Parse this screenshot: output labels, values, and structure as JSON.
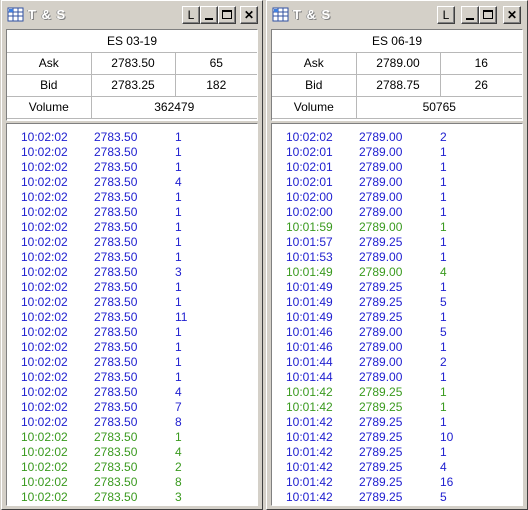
{
  "colors": {
    "buy": "#2020d0",
    "sell": "#3a9a1e",
    "window": "#d4d0c8"
  },
  "windows": [
    {
      "title": "T & S",
      "icon": "grid-app-icon",
      "buttons": {
        "link": "L"
      },
      "symbol": "ES 03-19",
      "ask_label": "Ask",
      "ask_price": "2783.50",
      "ask_size": "65",
      "bid_label": "Bid",
      "bid_price": "2783.25",
      "bid_size": "182",
      "volume_label": "Volume",
      "volume": "362479",
      "trades": [
        {
          "time": "10:02:02",
          "price": "2783.50",
          "size": "1",
          "side": "blue"
        },
        {
          "time": "10:02:02",
          "price": "2783.50",
          "size": "1",
          "side": "blue"
        },
        {
          "time": "10:02:02",
          "price": "2783.50",
          "size": "1",
          "side": "blue"
        },
        {
          "time": "10:02:02",
          "price": "2783.50",
          "size": "4",
          "side": "blue"
        },
        {
          "time": "10:02:02",
          "price": "2783.50",
          "size": "1",
          "side": "blue"
        },
        {
          "time": "10:02:02",
          "price": "2783.50",
          "size": "1",
          "side": "blue"
        },
        {
          "time": "10:02:02",
          "price": "2783.50",
          "size": "1",
          "side": "blue"
        },
        {
          "time": "10:02:02",
          "price": "2783.50",
          "size": "1",
          "side": "blue"
        },
        {
          "time": "10:02:02",
          "price": "2783.50",
          "size": "1",
          "side": "blue"
        },
        {
          "time": "10:02:02",
          "price": "2783.50",
          "size": "3",
          "side": "blue"
        },
        {
          "time": "10:02:02",
          "price": "2783.50",
          "size": "1",
          "side": "blue"
        },
        {
          "time": "10:02:02",
          "price": "2783.50",
          "size": "1",
          "side": "blue"
        },
        {
          "time": "10:02:02",
          "price": "2783.50",
          "size": "11",
          "side": "blue"
        },
        {
          "time": "10:02:02",
          "price": "2783.50",
          "size": "1",
          "side": "blue"
        },
        {
          "time": "10:02:02",
          "price": "2783.50",
          "size": "1",
          "side": "blue"
        },
        {
          "time": "10:02:02",
          "price": "2783.50",
          "size": "1",
          "side": "blue"
        },
        {
          "time": "10:02:02",
          "price": "2783.50",
          "size": "1",
          "side": "blue"
        },
        {
          "time": "10:02:02",
          "price": "2783.50",
          "size": "4",
          "side": "blue"
        },
        {
          "time": "10:02:02",
          "price": "2783.50",
          "size": "7",
          "side": "blue"
        },
        {
          "time": "10:02:02",
          "price": "2783.50",
          "size": "8",
          "side": "blue"
        },
        {
          "time": "10:02:02",
          "price": "2783.50",
          "size": "1",
          "side": "green"
        },
        {
          "time": "10:02:02",
          "price": "2783.50",
          "size": "4",
          "side": "green"
        },
        {
          "time": "10:02:02",
          "price": "2783.50",
          "size": "2",
          "side": "green"
        },
        {
          "time": "10:02:02",
          "price": "2783.50",
          "size": "8",
          "side": "green"
        },
        {
          "time": "10:02:02",
          "price": "2783.50",
          "size": "3",
          "side": "green"
        }
      ]
    },
    {
      "title": "T & S",
      "icon": "grid-app-icon",
      "buttons": {
        "link": "L"
      },
      "symbol": "ES 06-19",
      "ask_label": "Ask",
      "ask_price": "2789.00",
      "ask_size": "16",
      "bid_label": "Bid",
      "bid_price": "2788.75",
      "bid_size": "26",
      "volume_label": "Volume",
      "volume": "50765",
      "trades": [
        {
          "time": "10:02:02",
          "price": "2789.00",
          "size": "2",
          "side": "blue"
        },
        {
          "time": "10:02:01",
          "price": "2789.00",
          "size": "1",
          "side": "blue"
        },
        {
          "time": "10:02:01",
          "price": "2789.00",
          "size": "1",
          "side": "blue"
        },
        {
          "time": "10:02:01",
          "price": "2789.00",
          "size": "1",
          "side": "blue"
        },
        {
          "time": "10:02:00",
          "price": "2789.00",
          "size": "1",
          "side": "blue"
        },
        {
          "time": "10:02:00",
          "price": "2789.00",
          "size": "1",
          "side": "blue"
        },
        {
          "time": "10:01:59",
          "price": "2789.00",
          "size": "1",
          "side": "green"
        },
        {
          "time": "10:01:57",
          "price": "2789.25",
          "size": "1",
          "side": "blue"
        },
        {
          "time": "10:01:53",
          "price": "2789.00",
          "size": "1",
          "side": "blue"
        },
        {
          "time": "10:01:49",
          "price": "2789.00",
          "size": "4",
          "side": "green"
        },
        {
          "time": "10:01:49",
          "price": "2789.25",
          "size": "1",
          "side": "blue"
        },
        {
          "time": "10:01:49",
          "price": "2789.25",
          "size": "5",
          "side": "blue"
        },
        {
          "time": "10:01:49",
          "price": "2789.25",
          "size": "1",
          "side": "blue"
        },
        {
          "time": "10:01:46",
          "price": "2789.00",
          "size": "5",
          "side": "blue"
        },
        {
          "time": "10:01:46",
          "price": "2789.00",
          "size": "1",
          "side": "blue"
        },
        {
          "time": "10:01:44",
          "price": "2789.00",
          "size": "2",
          "side": "blue"
        },
        {
          "time": "10:01:44",
          "price": "2789.00",
          "size": "1",
          "side": "blue"
        },
        {
          "time": "10:01:42",
          "price": "2789.25",
          "size": "1",
          "side": "green"
        },
        {
          "time": "10:01:42",
          "price": "2789.25",
          "size": "1",
          "side": "green"
        },
        {
          "time": "10:01:42",
          "price": "2789.25",
          "size": "1",
          "side": "blue"
        },
        {
          "time": "10:01:42",
          "price": "2789.25",
          "size": "10",
          "side": "blue"
        },
        {
          "time": "10:01:42",
          "price": "2789.25",
          "size": "1",
          "side": "blue"
        },
        {
          "time": "10:01:42",
          "price": "2789.25",
          "size": "4",
          "side": "blue"
        },
        {
          "time": "10:01:42",
          "price": "2789.25",
          "size": "16",
          "side": "blue"
        },
        {
          "time": "10:01:42",
          "price": "2789.25",
          "size": "5",
          "side": "blue"
        }
      ]
    }
  ]
}
